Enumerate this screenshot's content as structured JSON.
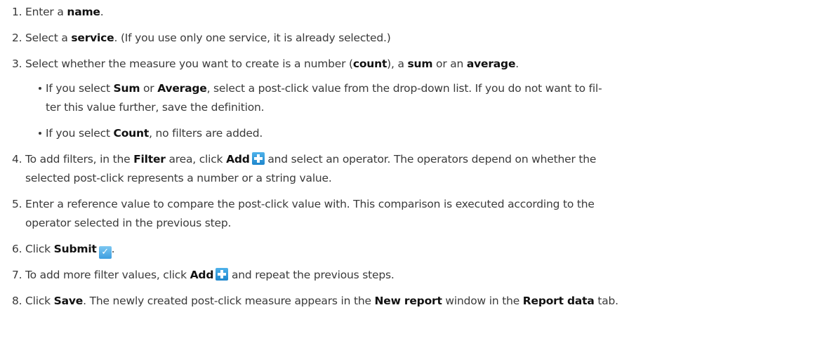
{
  "steps": [
    {
      "num": "1.",
      "t1": "Enter a ",
      "b1": "name",
      "t2": "."
    },
    {
      "num": "2.",
      "t1": "Select a ",
      "b1": "service",
      "t2": ". (If you use only one service, it is already selected.)"
    },
    {
      "num": "3.",
      "t1": "Select whether the measure you want to create is a number (",
      "b1": "count",
      "t2": "), a ",
      "b2": "sum",
      "t3": " or an ",
      "b3": "average",
      "t4": ".",
      "bullets": [
        {
          "t1": "If you select ",
          "b1": "Sum",
          "t2": " or ",
          "b2": "Average",
          "t3": ", select a post-click value from the drop-down list. If you do not want to fil-",
          "t4": "ter this value further, save the definition."
        },
        {
          "t1": "If you select ",
          "b1": "Count",
          "t2": ", no filters are added."
        }
      ]
    },
    {
      "num": "4.",
      "t1": "To add filters, in the ",
      "b1": "Filter",
      "t2": " area, click ",
      "b2": "Add",
      "t3": " and select an operator. The operators depend on whether the",
      "t4": "selected post-click represents a number or a string value."
    },
    {
      "num": "5.",
      "t1": "Enter a reference value to compare the post-click value with. This comparison is executed according to the",
      "t2": "operator selected in the previous step."
    },
    {
      "num": "6.",
      "t1": "Click ",
      "b1": "Submit",
      "t2": "."
    },
    {
      "num": "7.",
      "t1": "To add more filter values, click ",
      "b1": "Add",
      "t2": " and repeat the previous steps."
    },
    {
      "num": "8.",
      "t1": "Click ",
      "b1": "Save",
      "t2": ". The newly created post-click measure appears in the ",
      "b2": "New report",
      "t3": " window in the ",
      "b3": "Report data",
      "t4": " tab."
    }
  ],
  "icons": {
    "add": "plus-icon",
    "submit": "checkmark-icon",
    "accent": "#2a92d6"
  }
}
